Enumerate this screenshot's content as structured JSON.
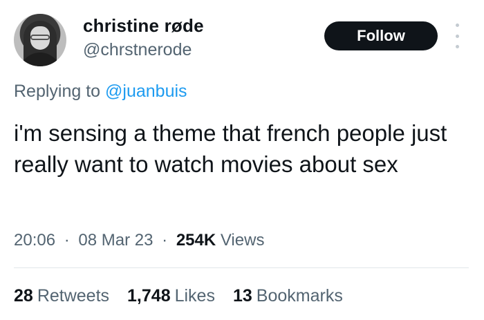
{
  "author": {
    "display_name": "christine røde",
    "handle": "@chrstnerode"
  },
  "actions": {
    "follow_label": "Follow",
    "more_icon": "more-vertical-icon"
  },
  "reply": {
    "prefix": "Replying to",
    "to_handle": "@juanbuis"
  },
  "tweet": {
    "text": "i'm sensing a theme that french people just really want to watch movies about sex"
  },
  "meta": {
    "time": "20:06",
    "date": "08 Mar 23",
    "separator": "·",
    "views_count": "254K",
    "views_label": "Views"
  },
  "stats": {
    "retweets_count": "28",
    "retweets_label": "Retweets",
    "likes_count": "1,748",
    "likes_label": "Likes",
    "bookmarks_count": "13",
    "bookmarks_label": "Bookmarks"
  },
  "colors": {
    "text": "#0f1419",
    "secondary": "#536471",
    "link": "#1d9bf0",
    "follow_bg": "#0f1419"
  }
}
